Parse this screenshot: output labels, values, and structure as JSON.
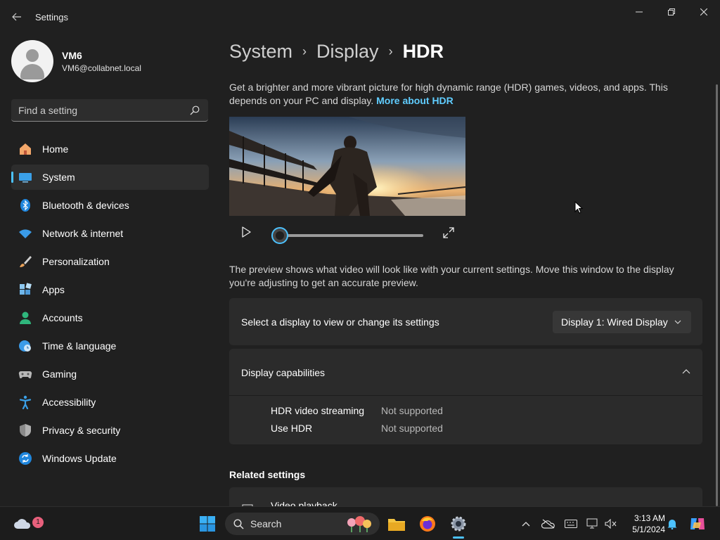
{
  "window": {
    "title": "Settings"
  },
  "user": {
    "name": "VM6",
    "email": "VM6@collabnet.local"
  },
  "search": {
    "placeholder": "Find a setting"
  },
  "nav": {
    "items": [
      {
        "label": "Home"
      },
      {
        "label": "System"
      },
      {
        "label": "Bluetooth & devices"
      },
      {
        "label": "Network & internet"
      },
      {
        "label": "Personalization"
      },
      {
        "label": "Apps"
      },
      {
        "label": "Accounts"
      },
      {
        "label": "Time & language"
      },
      {
        "label": "Gaming"
      },
      {
        "label": "Accessibility"
      },
      {
        "label": "Privacy & security"
      },
      {
        "label": "Windows Update"
      }
    ],
    "active": "System"
  },
  "breadcrumb": {
    "level1": "System",
    "level2": "Display",
    "current": "HDR"
  },
  "intro": {
    "text": "Get a brighter and more vibrant picture for high dynamic range (HDR) games, videos, and apps. This depends on your PC and display.",
    "link": "More about HDR"
  },
  "preview": {
    "progress": 0,
    "note": "The preview shows what video will look like with your current settings. Move this window to the display you're adjusting to get an accurate preview."
  },
  "display_select": {
    "label": "Select a display to view or change its settings",
    "selected": "Display 1: Wired Display"
  },
  "capabilities": {
    "title": "Display capabilities",
    "rows": [
      {
        "name": "HDR video streaming",
        "value": "Not supported"
      },
      {
        "name": "Use HDR",
        "value": "Not supported"
      }
    ]
  },
  "related": {
    "title": "Related settings",
    "first_item": "Video playback"
  },
  "taskbar": {
    "search_label": "Search",
    "time": "3:13 AM",
    "date": "5/1/2024",
    "weather_badge": "1"
  },
  "colors": {
    "accent": "#4cc2ff",
    "link": "#60cdff",
    "background": "#202020",
    "card": "#2b2b2b"
  }
}
